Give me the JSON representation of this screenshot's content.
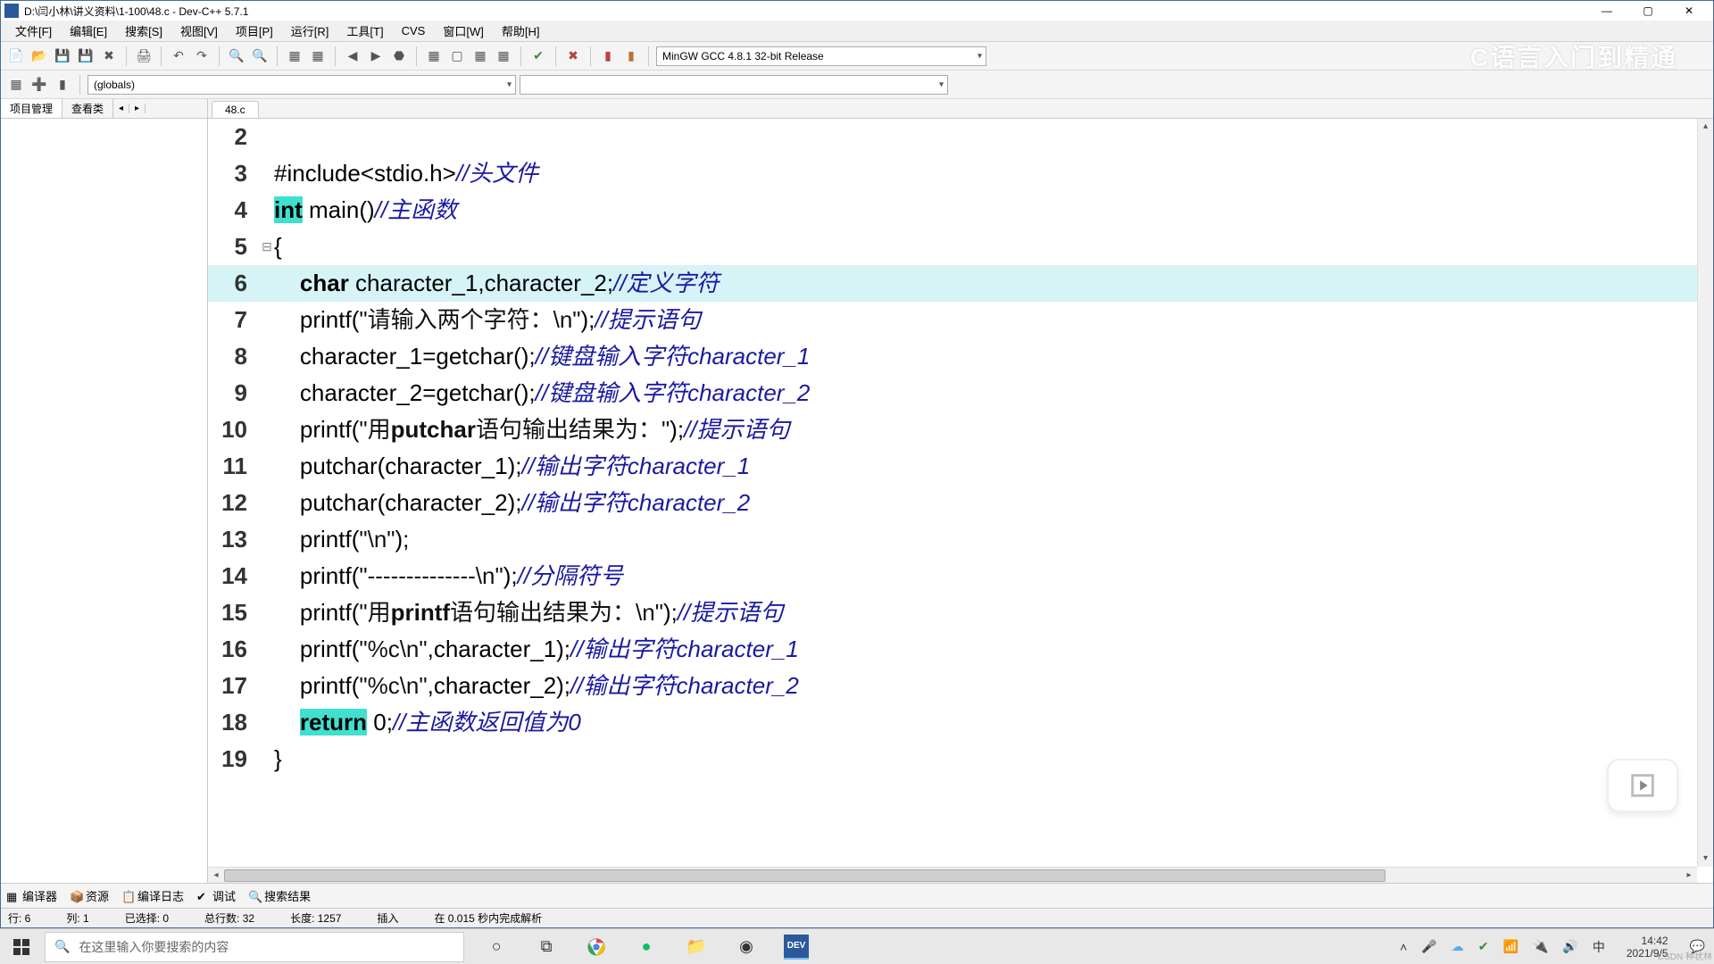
{
  "title": "D:\\闫小林\\讲义资料\\1-100\\48.c - Dev-C++ 5.7.1",
  "menu": [
    "文件[F]",
    "编辑[E]",
    "搜索[S]",
    "视图[V]",
    "项目[P]",
    "运行[R]",
    "工具[T]",
    "CVS",
    "窗口[W]",
    "帮助[H]"
  ],
  "compiler_select": "MinGW GCC 4.8.1 32-bit Release",
  "watermark": "C语言入门到精通",
  "globals_select": "(globals)",
  "sidebar": {
    "tabs": [
      "项目管理",
      "查看类"
    ],
    "arrows": [
      "◂",
      "▸"
    ]
  },
  "doc_tab": "48.c",
  "code": [
    {
      "n": 2,
      "fold": "",
      "seg": []
    },
    {
      "n": 3,
      "fold": "",
      "seg": [
        {
          "c": "pl",
          "t": "#include<stdio.h>"
        },
        {
          "c": "cmt",
          "t": "//头文件"
        }
      ]
    },
    {
      "n": 4,
      "fold": "",
      "seg": [
        {
          "c": "kw-hl",
          "t": "int"
        },
        {
          "c": "pl",
          "t": " main()"
        },
        {
          "c": "cmt",
          "t": "//主函数"
        }
      ]
    },
    {
      "n": 5,
      "fold": "⊟",
      "seg": [
        {
          "c": "pl",
          "t": "{"
        }
      ]
    },
    {
      "n": 6,
      "fold": "",
      "hl": true,
      "seg": [
        {
          "c": "pl",
          "t": "    "
        },
        {
          "c": "kw bold",
          "t": "char"
        },
        {
          "c": "pl",
          "t": " character_1,character_2;"
        },
        {
          "c": "cmt",
          "t": "//定义字符"
        }
      ]
    },
    {
      "n": 7,
      "fold": "",
      "seg": [
        {
          "c": "pl",
          "t": "    printf("
        },
        {
          "c": "str",
          "t": "\"请输入两个字符：\\n\""
        },
        {
          "c": "pl",
          "t": ");"
        },
        {
          "c": "cmt",
          "t": "//提示语句"
        }
      ]
    },
    {
      "n": 8,
      "fold": "",
      "seg": [
        {
          "c": "pl",
          "t": "    character_1=getchar();"
        },
        {
          "c": "cmt",
          "t": "//键盘输入字符character_1"
        }
      ]
    },
    {
      "n": 9,
      "fold": "",
      "seg": [
        {
          "c": "pl",
          "t": "    character_2=getchar();"
        },
        {
          "c": "cmt",
          "t": "//键盘输入字符character_2"
        }
      ]
    },
    {
      "n": 10,
      "fold": "",
      "seg": [
        {
          "c": "pl",
          "t": "    printf("
        },
        {
          "c": "str",
          "t": "\"用"
        },
        {
          "c": "str bold",
          "t": "putchar"
        },
        {
          "c": "str",
          "t": "语句输出结果为：\""
        },
        {
          "c": "pl",
          "t": ");"
        },
        {
          "c": "cmt",
          "t": "//提示语句"
        }
      ]
    },
    {
      "n": 11,
      "fold": "",
      "seg": [
        {
          "c": "pl",
          "t": "    putchar(character_1);"
        },
        {
          "c": "cmt",
          "t": "//输出字符character_1"
        }
      ]
    },
    {
      "n": 12,
      "fold": "",
      "seg": [
        {
          "c": "pl",
          "t": "    putchar(character_2);"
        },
        {
          "c": "cmt",
          "t": "//输出字符character_2"
        }
      ]
    },
    {
      "n": 13,
      "fold": "",
      "seg": [
        {
          "c": "pl",
          "t": "    printf("
        },
        {
          "c": "str",
          "t": "\"\\n\""
        },
        {
          "c": "pl",
          "t": ");"
        }
      ]
    },
    {
      "n": 14,
      "fold": "",
      "seg": [
        {
          "c": "pl",
          "t": "    printf("
        },
        {
          "c": "str",
          "t": "\"--------------\\n\""
        },
        {
          "c": "pl",
          "t": ");"
        },
        {
          "c": "cmt",
          "t": "//分隔符号"
        }
      ]
    },
    {
      "n": 15,
      "fold": "",
      "seg": [
        {
          "c": "pl",
          "t": "    printf("
        },
        {
          "c": "str",
          "t": "\"用"
        },
        {
          "c": "str bold",
          "t": "printf"
        },
        {
          "c": "str",
          "t": "语句输出结果为：\\n\""
        },
        {
          "c": "pl",
          "t": ");"
        },
        {
          "c": "cmt",
          "t": "//提示语句"
        }
      ]
    },
    {
      "n": 16,
      "fold": "",
      "seg": [
        {
          "c": "pl",
          "t": "    printf("
        },
        {
          "c": "str",
          "t": "\"%c\\n\""
        },
        {
          "c": "pl",
          "t": ",character_1);"
        },
        {
          "c": "cmt",
          "t": "//输出字符character_1"
        }
      ]
    },
    {
      "n": 17,
      "fold": "",
      "seg": [
        {
          "c": "pl",
          "t": "    printf("
        },
        {
          "c": "str",
          "t": "\"%c\\n\""
        },
        {
          "c": "pl",
          "t": ",character_2);"
        },
        {
          "c": "cmt",
          "t": "//输出字符character_2"
        }
      ]
    },
    {
      "n": 18,
      "fold": "",
      "seg": [
        {
          "c": "pl",
          "t": "    "
        },
        {
          "c": "kw-hl",
          "t": "return"
        },
        {
          "c": "pl",
          "t": " 0;"
        },
        {
          "c": "cmt",
          "t": "//主函数返回值为0"
        }
      ]
    },
    {
      "n": 19,
      "fold": "",
      "seg": [
        {
          "c": "pl",
          "t": "}"
        }
      ]
    }
  ],
  "bottom_tabs": [
    "编译器",
    "资源",
    "编译日志",
    "调试",
    "搜索结果"
  ],
  "status": {
    "line": "行:  6",
    "col": "列:  1",
    "sel": "已选择:   0",
    "total": "总行数:   32",
    "len": "长度:  1257",
    "mode": "插入",
    "parse": "在 0.015 秒内完成解析"
  },
  "taskbar": {
    "search_placeholder": "在这里输入你要搜索的内容",
    "ime": "中",
    "time": "14:42",
    "date": "2021/9/5"
  },
  "csdn": "CSDN 种状林"
}
